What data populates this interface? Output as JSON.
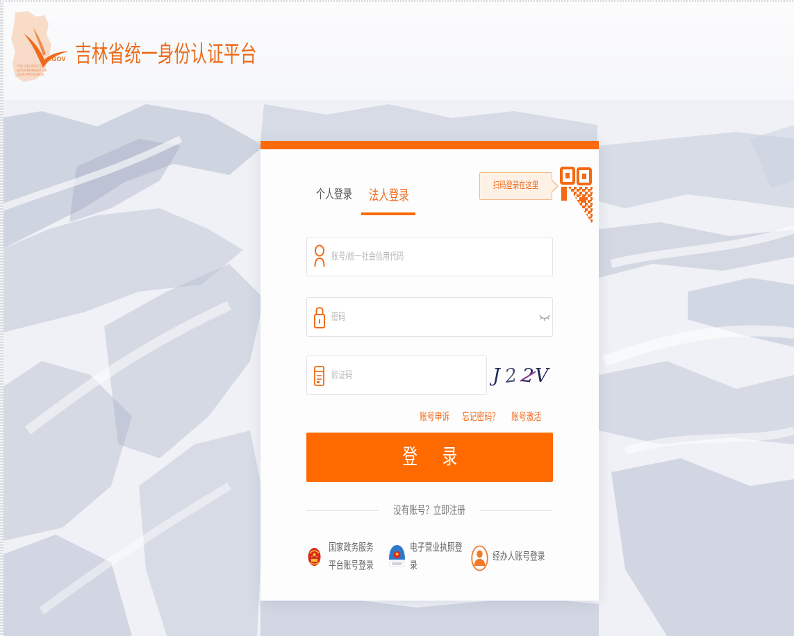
{
  "header": {
    "logo": {
      "gov_text": ".GOV",
      "small_text": [
        "THE PEOPLE'S",
        "GOVERNMENT OF",
        "JILIN PROVINCE"
      ]
    },
    "title": "吉林省统一身份认证平台"
  },
  "login": {
    "tabs": [
      {
        "label": "个人登录",
        "active": false
      },
      {
        "label": "法人登录",
        "active": true
      }
    ],
    "qr_hint": "扫码登录在这里",
    "qr_icon": "qr-code-icon",
    "account": {
      "placeholder": "账号/统一社会信用代码",
      "value": "",
      "icon": "user-icon"
    },
    "password": {
      "placeholder": "密码",
      "value": "",
      "icon": "lock-icon",
      "toggle_icon": "eye-closed-icon"
    },
    "captcha": {
      "placeholder": "验证码",
      "value": "",
      "icon": "captcha-icon",
      "image_chars": [
        "J",
        "2",
        "2",
        "V"
      ]
    },
    "links": {
      "appeal": "账号申诉",
      "forgot": "忘记密码？",
      "activate": "账号激活"
    },
    "submit_label": "登 录",
    "register_prompt": "没有账号？立即注册",
    "alt_logins": [
      {
        "lines": [
          "国家政务服务",
          "平台账号登录"
        ],
        "icon": "national-emblem-icon"
      },
      {
        "lines": [
          "电子营业执照登",
          "录"
        ],
        "icon": "business-license-emblem-icon"
      },
      {
        "lines": [
          "经办人账号登录"
        ],
        "icon": "agent-person-icon"
      }
    ]
  },
  "colors": {
    "accent": "#ff6a00",
    "title": "#ea6c1b",
    "link": "#ef6a1d",
    "text_muted": "#666666",
    "placeholder": "#b8b8b8"
  }
}
